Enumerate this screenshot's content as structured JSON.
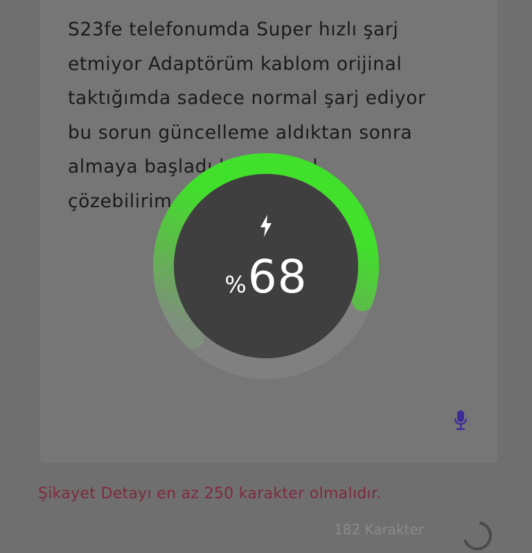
{
  "complaint": {
    "text": "S23fe telefonumda Super hızlı şarj\netmiyor Adaptörüm kablom orijinal\ntaktığımda sadece normal şarj ediyor\nbu sorun güncelleme aldıktan sonra\nalmaya başladı bunu nasıl\nçözebilirim"
  },
  "validation": {
    "error": "Şikayet Detayı en az 250 karakter olmalıdır.",
    "counter": "182 Karakter"
  },
  "icons": {
    "mic": "microphone-icon",
    "bolt": "charging-bolt-icon"
  },
  "charging": {
    "percent_sign": "%",
    "percent_value": "68",
    "level": 0.68
  },
  "colors": {
    "accent_green": "#41e02b",
    "mic_purple": "#3c2c9a",
    "error_red": "#7e2a3e"
  }
}
